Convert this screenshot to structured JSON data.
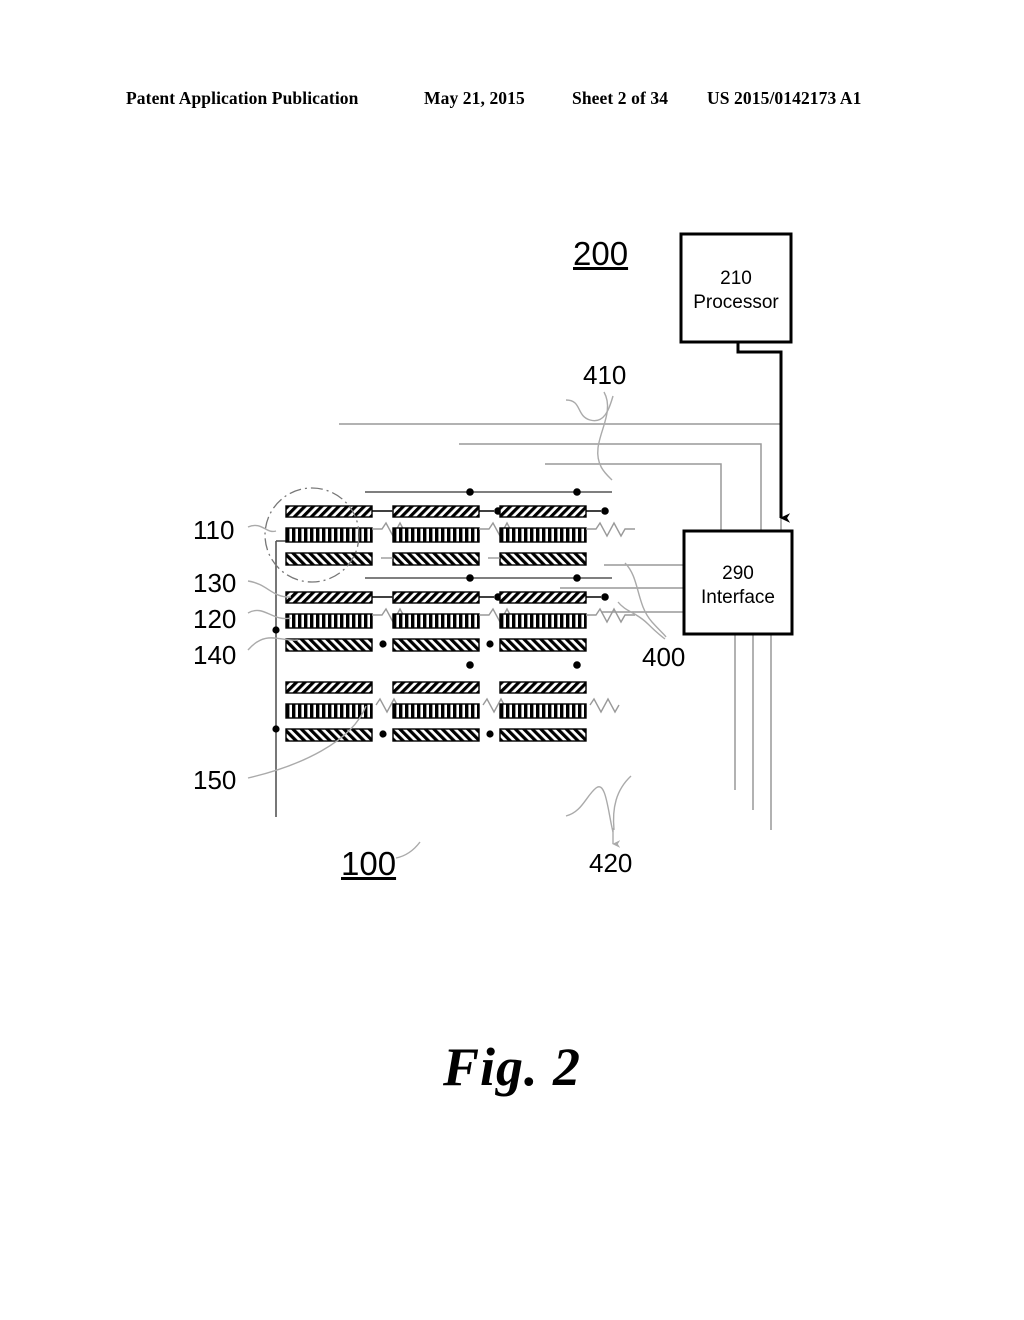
{
  "header": {
    "publication": "Patent Application Publication",
    "date": "May 21, 2015",
    "sheet": "Sheet 2 of 34",
    "document_number": "US 2015/0142173 A1"
  },
  "figure": {
    "caption": "Fig. 2",
    "system_label": "200",
    "array_label": "100",
    "boxes": [
      {
        "id": "processor",
        "number": "210",
        "name": "Processor"
      },
      {
        "id": "interface",
        "number": "290",
        "name": "Interface"
      }
    ],
    "reference_numerals": [
      {
        "id": "110",
        "text": "110"
      },
      {
        "id": "130",
        "text": "130"
      },
      {
        "id": "120",
        "text": "120"
      },
      {
        "id": "140",
        "text": "140"
      },
      {
        "id": "150",
        "text": "150"
      },
      {
        "id": "400",
        "text": "400"
      },
      {
        "id": "410",
        "text": "410"
      },
      {
        "id": "420",
        "text": "420"
      }
    ],
    "colors": {
      "ink": "#000000",
      "wire_gray": "#999999",
      "leader_gray": "#aaaaaa",
      "paper": "#ffffff"
    },
    "memory_cells": {
      "rows": 3,
      "columns": 3,
      "layers": [
        "top-electrode",
        "storage-layer",
        "bottom-electrode"
      ],
      "resistor_symbol": "zigzag"
    }
  }
}
